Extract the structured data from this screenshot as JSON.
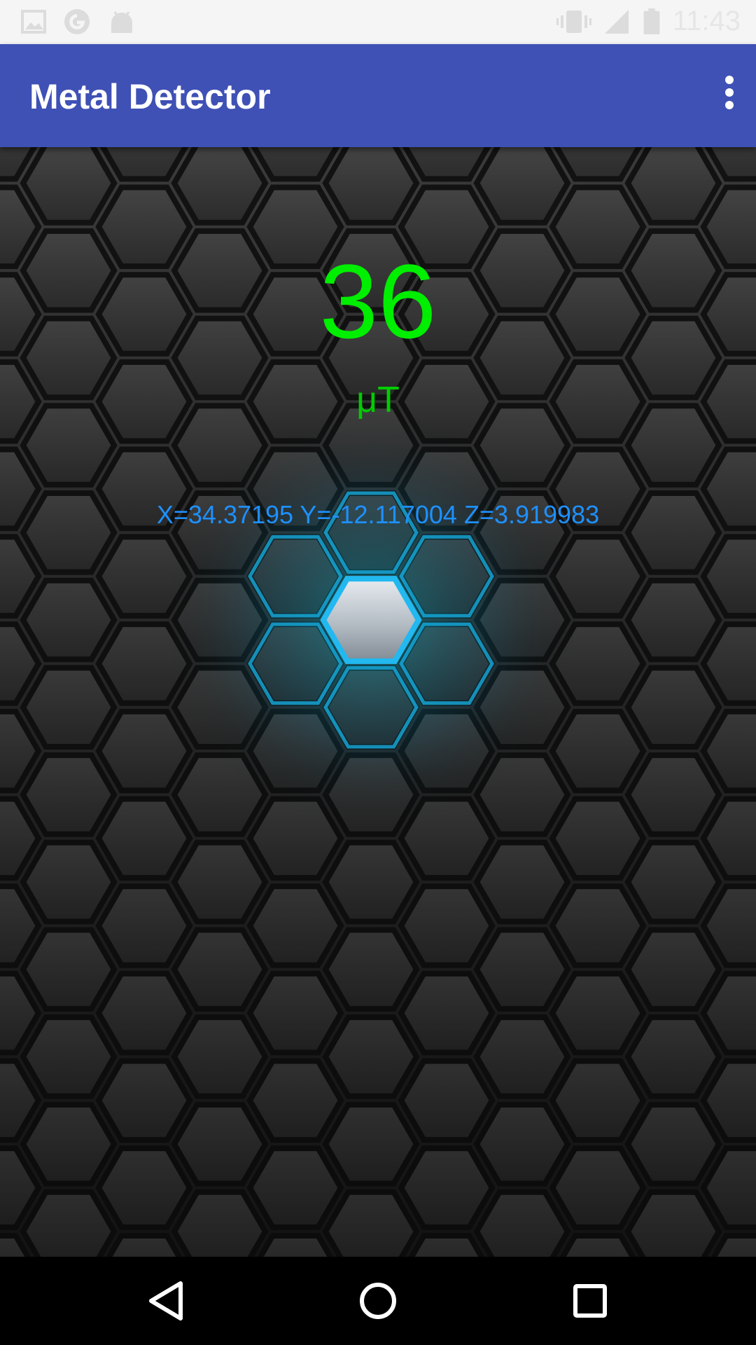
{
  "status_bar": {
    "time": "11:43",
    "icons": [
      "image-icon",
      "google-icon",
      "android-icon",
      "vibrate-icon",
      "signal-icon",
      "battery-icon"
    ]
  },
  "app_bar": {
    "title": "Metal Detector",
    "menu_icon": "more-vert-icon",
    "color": "#3f51b5"
  },
  "reading": {
    "value": "36",
    "unit": "μT",
    "axes": "X=34.37195 Y=-12.117004 Z=3.919983",
    "value_color": "#00ee00",
    "axes_color": "#1e90ff"
  },
  "nav_bar": {
    "back_icon": "back-triangle-icon",
    "home_icon": "home-circle-icon",
    "recents_icon": "recents-square-icon"
  }
}
